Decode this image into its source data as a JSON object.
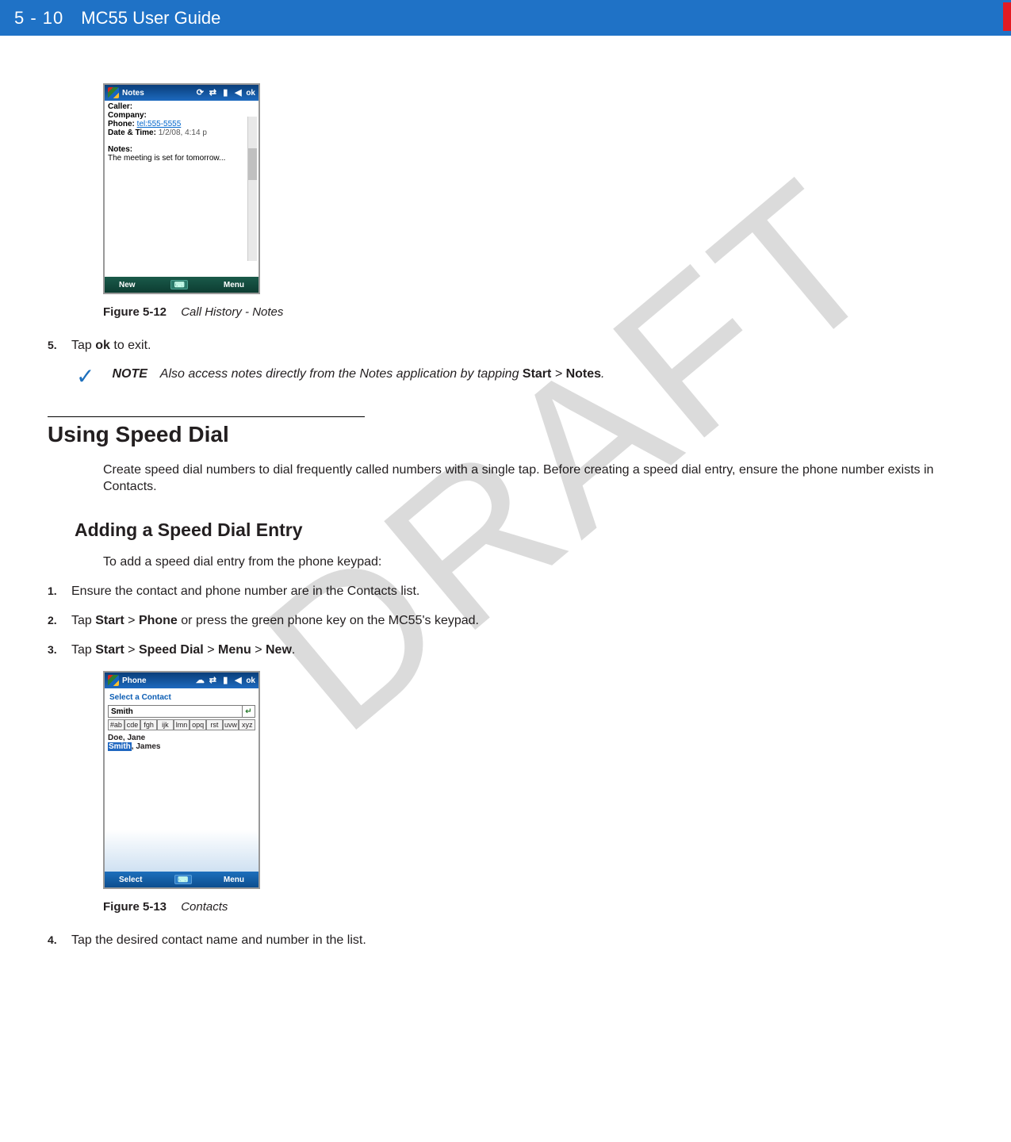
{
  "header": {
    "page_number": "5 - 10",
    "guide_title": "MC55 User Guide"
  },
  "watermark": "DRAFT",
  "device1": {
    "title": "Notes",
    "ok": "ok",
    "caller_label": "Caller:",
    "company_label": "Company:",
    "phone_label": "Phone:",
    "phone_value": "tel:555-5555",
    "datetime_label": "Date & Time:",
    "datetime_value": "1/2/08, 4:14 p",
    "notes_label": "Notes:",
    "notes_body": "The meeting is set for tomorrow...",
    "btn_left": "New",
    "btn_right": "Menu"
  },
  "fig1": {
    "label": "Figure 5-12",
    "title": "Call History - Notes"
  },
  "step5": {
    "num": "5.",
    "pre": "Tap ",
    "bold": "ok",
    "post": " to exit."
  },
  "note": {
    "label": "NOTE",
    "pre": "Also access notes directly from the Notes application by tapping ",
    "b1": "Start",
    "mid": " > ",
    "b2": "Notes",
    "post": "."
  },
  "section": {
    "heading": "Using Speed Dial",
    "para": "Create speed dial numbers to dial frequently called numbers with a single tap. Before creating a speed dial entry, ensure the phone number exists in Contacts."
  },
  "subsection": {
    "heading": "Adding a Speed Dial Entry",
    "intro": "To add a speed dial entry from the phone keypad:"
  },
  "steps": {
    "s1": {
      "num": "1.",
      "text": "Ensure the contact and phone number are in the Contacts list."
    },
    "s2": {
      "num": "2.",
      "pre": "Tap ",
      "b1": "Start",
      "m1": " > ",
      "b2": "Phone",
      "post": " or press the green phone key on the MC55's keypad."
    },
    "s3": {
      "num": "3.",
      "pre": "Tap ",
      "b1": "Start",
      "m1": " > ",
      "b2": "Speed Dial",
      "m2": " > ",
      "b3": "Menu",
      "m3": " > ",
      "b4": "New",
      "post": "."
    }
  },
  "device2": {
    "title": "Phone",
    "ok": "ok",
    "subtitle": "Select a Contact",
    "search_value": "Smith",
    "alpha": [
      "#ab",
      "cde",
      "fgh",
      "ijk",
      "lmn",
      "opq",
      "rst",
      "uvw",
      "xyz"
    ],
    "contact1": "Doe, Jane",
    "contact2_match": "Smith",
    "contact2_rest": ", James",
    "btn_left": "Select",
    "btn_right": "Menu"
  },
  "fig2": {
    "label": "Figure 5-13",
    "title": "Contacts"
  },
  "step_post": {
    "num": "4.",
    "text": "Tap the desired contact name and number in the list."
  }
}
